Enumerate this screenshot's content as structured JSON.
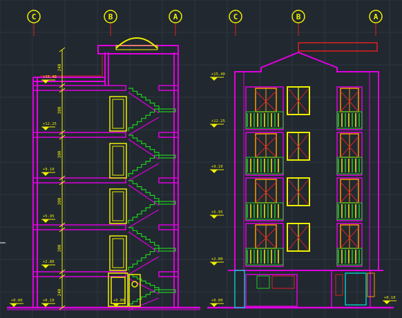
{
  "drawing": {
    "grid_color": "#2d3742",
    "background": "#212830",
    "colors": {
      "magenta": "#e000e0",
      "yellow": "#f0f000",
      "red": "#e02020",
      "green": "#20d020",
      "cyan": "#00c8c8",
      "white": "#ffffff",
      "orange": "#ff9900"
    }
  },
  "section": {
    "axis_labels": [
      "C",
      "B",
      "A"
    ],
    "level_marks": [
      "+15.40",
      "+12.25",
      "+9.10",
      "+5.95",
      "+2.80",
      "+0.00",
      "+0.10",
      "+0.80"
    ],
    "dims": [
      "240",
      "300",
      "310",
      "300",
      "315",
      "300",
      "315",
      "300",
      "315",
      "300",
      "240"
    ],
    "icon": "section-drawing"
  },
  "elevation": {
    "axis_labels": [
      "C",
      "B",
      "A"
    ],
    "level_marks": [
      "+15.40",
      "+12.25",
      "+9.10",
      "+5.95",
      "+2.80",
      "+0.10",
      "+0.00"
    ],
    "icon": "front-elevation-drawing"
  }
}
